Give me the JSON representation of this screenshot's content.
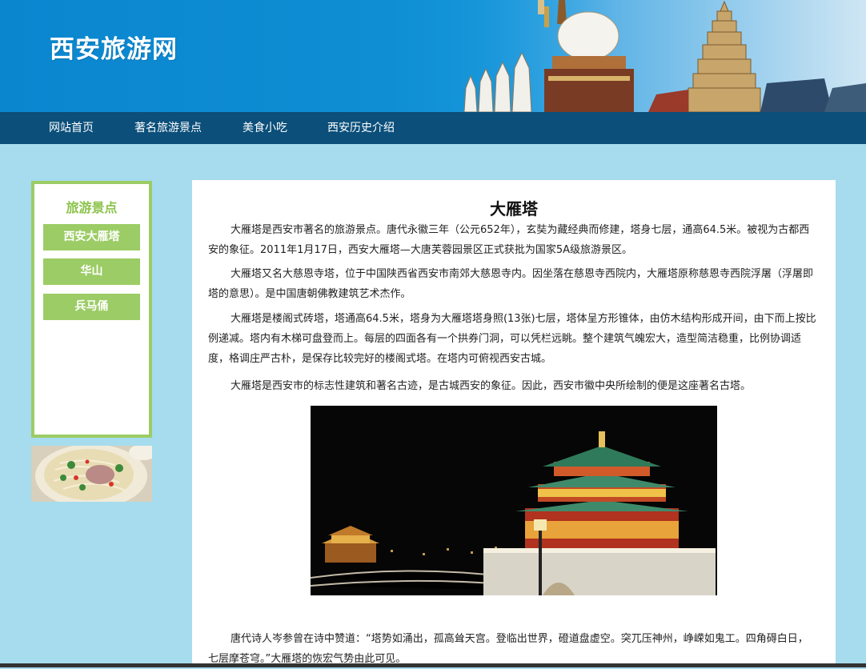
{
  "header": {
    "site_title": "西安旅游网"
  },
  "nav": {
    "items": [
      "网站首页",
      "著名旅游景点",
      "美食小吃",
      "西安历史介绍"
    ]
  },
  "sidebar": {
    "title": "旅游景点",
    "items": [
      "西安大雁塔",
      "华山",
      "兵马俑"
    ]
  },
  "main": {
    "title": "大雁塔",
    "paragraphs": [
      "大雁塔是西安市著名的旅游景点。唐代永徽三年（公元652年），玄奘为藏经典而修建，塔身七层，通高64.5米。被视为古都西安的象征。2011年1月17日，西安大雁塔—大唐芙蓉园景区正式获批为国家5A级旅游景区。",
      "大雁塔又名大慈恩寺塔，位于中国陕西省西安市南郊大慈恩寺内。因坐落在慈恩寺西院内，大雁塔原称慈恩寺西院浮屠（浮屠即塔的意思）。是中国唐朝佛教建筑艺术杰作。",
      "大雁塔是楼阁式砖塔，塔通高64.5米，塔身为大雁塔塔身照(13张)七层，塔体呈方形锥体，由仿木结构形成开间，由下而上按比例递减。塔内有木梯可盘登而上。每层的四面各有一个拱券门洞，可以凭栏远眺。整个建筑气魄宏大，造型简洁稳重，比例协调适度，格调庄严古朴，是保存比较完好的楼阁式塔。在塔内可俯视西安古城。",
      "大雁塔是西安市的标志性建筑和著名古迹，是古城西安的象征。因此，西安市徽中央所绘制的便是这座著名古塔。",
      "唐代诗人岑参曾在诗中赞道：“塔势如涌出，孤高耸天宫。登临出世界，磴道盘虚空。突兀压神州，峥嵘如鬼工。四角碍白日，七层摩苍穹。”大雁塔的恢宏气势由此可见。"
    ]
  },
  "colors": {
    "header_blue": "#0a86cf",
    "nav_bg": "#0b4f7a",
    "page_bg": "#a6dcee",
    "accent_green": "#9ccc65"
  }
}
